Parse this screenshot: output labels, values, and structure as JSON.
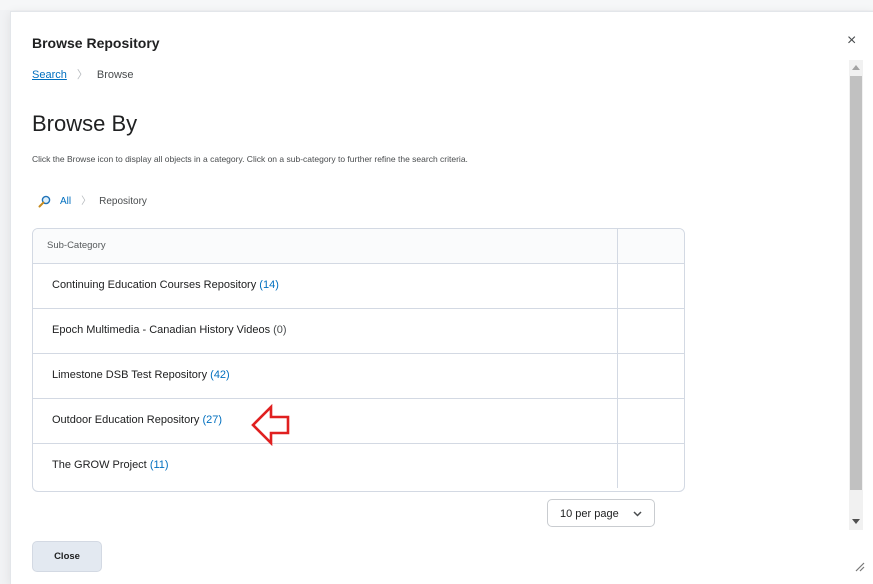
{
  "dialog": {
    "title": "Browse Repository",
    "close_glyph": "×",
    "breadcrumb": {
      "link": "Search",
      "separator": "〉",
      "current": "Browse"
    }
  },
  "main": {
    "heading": "Browse By",
    "instructions": "Click the Browse icon to display all objects in a category. Click on a sub-category to further refine the search criteria.",
    "path": {
      "icon": "magnifier-icon",
      "link": "All",
      "separator": "〉",
      "current": "Repository"
    }
  },
  "table": {
    "header": "Sub-Category",
    "rows": [
      {
        "name": "Continuing Education Courses Repository",
        "count": "(14)"
      },
      {
        "name": "Epoch Multimedia - Canadian History Videos",
        "count": "(0)"
      },
      {
        "name": "Limestone DSB Test Repository",
        "count": "(42)"
      },
      {
        "name": "Outdoor Education Repository",
        "count": "(27)"
      },
      {
        "name": "The GROW Project",
        "count": "(11)"
      }
    ]
  },
  "pagination": {
    "per_page": "10 per page"
  },
  "footer": {
    "close_label": "Close"
  },
  "colors": {
    "link": "#006fbf",
    "annotation_arrow": "#e02020",
    "close_button_bg": "#e3e9f1"
  }
}
